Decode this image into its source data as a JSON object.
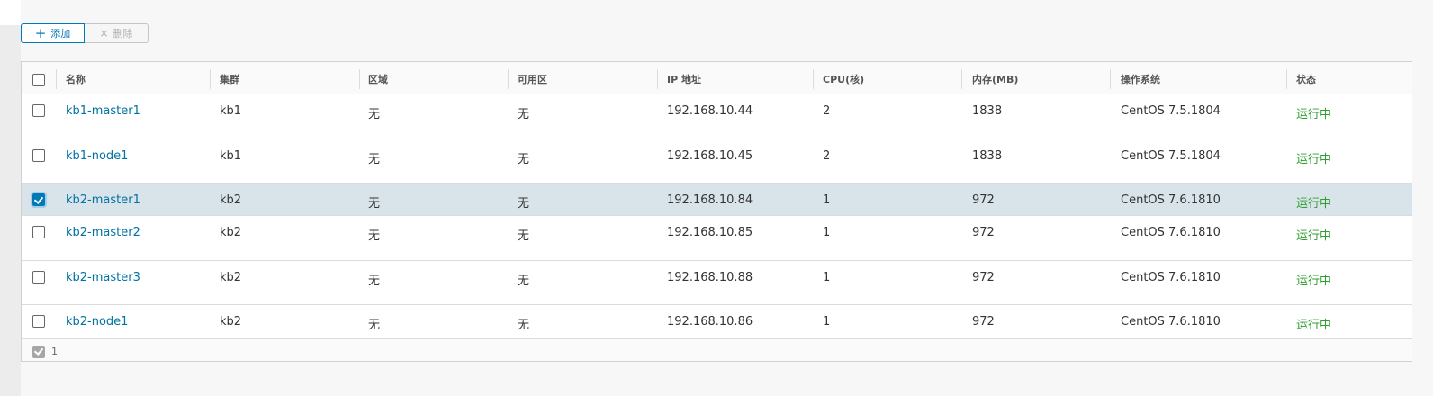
{
  "toolbar": {
    "add_label": "添加",
    "delete_label": "删除"
  },
  "table": {
    "columns": [
      "名称",
      "集群",
      "区域",
      "可用区",
      "IP 地址",
      "CPU(核)",
      "内存(MB)",
      "操作系统",
      "状态"
    ],
    "rows": [
      {
        "name": "kb1-master1",
        "cluster": "kb1",
        "region": "无",
        "zone": "无",
        "ip": "192.168.10.44",
        "cpu": "2",
        "memory": "1838",
        "os": "CentOS 7.5.1804",
        "status": "运行中",
        "selected": false
      },
      {
        "name": "kb1-node1",
        "cluster": "kb1",
        "region": "无",
        "zone": "无",
        "ip": "192.168.10.45",
        "cpu": "2",
        "memory": "1838",
        "os": "CentOS 7.5.1804",
        "status": "运行中",
        "selected": false
      },
      {
        "name": "kb2-master1",
        "cluster": "kb2",
        "region": "无",
        "zone": "无",
        "ip": "192.168.10.84",
        "cpu": "1",
        "memory": "972",
        "os": "CentOS 7.6.1810",
        "status": "运行中",
        "selected": true
      },
      {
        "name": "kb2-master2",
        "cluster": "kb2",
        "region": "无",
        "zone": "无",
        "ip": "192.168.10.85",
        "cpu": "1",
        "memory": "972",
        "os": "CentOS 7.6.1810",
        "status": "运行中",
        "selected": false
      },
      {
        "name": "kb2-master3",
        "cluster": "kb2",
        "region": "无",
        "zone": "无",
        "ip": "192.168.10.88",
        "cpu": "1",
        "memory": "972",
        "os": "CentOS 7.6.1810",
        "status": "运行中",
        "selected": false
      },
      {
        "name": "kb2-node1",
        "cluster": "kb2",
        "region": "无",
        "zone": "无",
        "ip": "192.168.10.86",
        "cpu": "1",
        "memory": "972",
        "os": "CentOS 7.6.1810",
        "status": "运行中",
        "selected": false
      }
    ]
  },
  "footer": {
    "selected_count": "1"
  },
  "colors": {
    "accent": "#0079b8",
    "link": "#0072a3",
    "status_running": "#2e9e2e",
    "selected_row": "#d9e4ea"
  },
  "icons": {
    "add": "plus-icon",
    "delete": "close-icon",
    "footer": "checkbox-checked-icon"
  }
}
